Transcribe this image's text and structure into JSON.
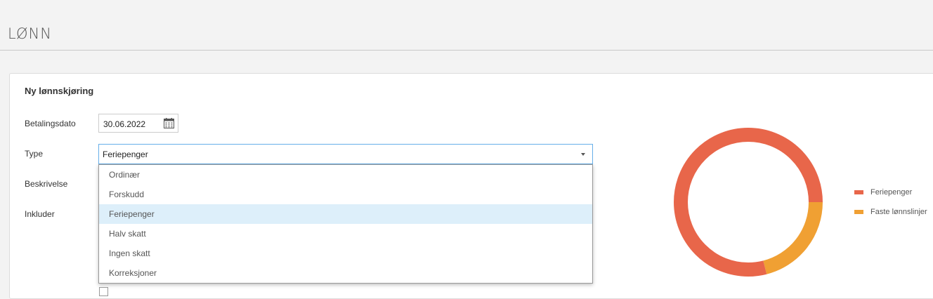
{
  "header": {
    "title": "LØNN"
  },
  "form": {
    "title": "Ny lønnskjøring",
    "labels": {
      "payment_date": "Betalingsdato",
      "type": "Type",
      "description": "Beskrivelse",
      "include": "Inkluder"
    },
    "payment_date_value": "30.06.2022",
    "type_value": "Feriepenger",
    "type_options": [
      {
        "label": "Ordinær",
        "selected": false
      },
      {
        "label": "Forskudd",
        "selected": false
      },
      {
        "label": "Feriepenger",
        "selected": true
      },
      {
        "label": "Halv skatt",
        "selected": false
      },
      {
        "label": "Ingen skatt",
        "selected": false
      },
      {
        "label": "Korreksjoner",
        "selected": false
      }
    ]
  },
  "chart_data": {
    "type": "pie",
    "categories": [
      "Feriepenger",
      "Faste lønnslinjer"
    ],
    "values": [
      79,
      21
    ],
    "colors": [
      "#e8664a",
      "#f0a033"
    ],
    "legend": "right"
  }
}
